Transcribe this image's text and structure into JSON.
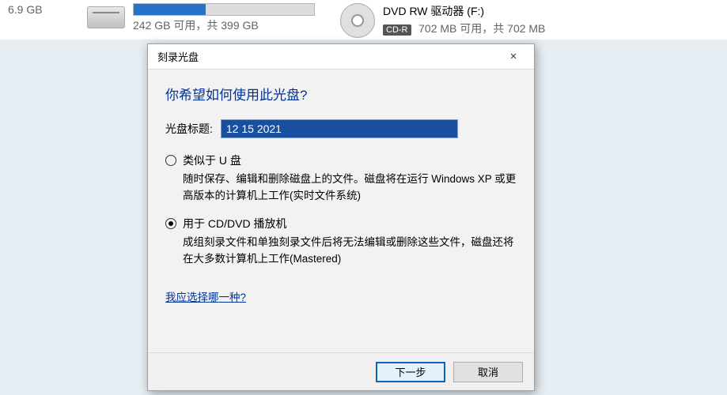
{
  "background": {
    "drive1_sub": "6.9 GB",
    "drive2_bar_fill_pct": 40,
    "drive2_sub": "242 GB 可用，共 399 GB",
    "cd_label": "DVD RW 驱动器 (F:)",
    "cd_badge": "CD-R",
    "cd_sub": "702 MB 可用，共 702 MB"
  },
  "dialog": {
    "title": "刻录光盘",
    "close_icon": "×",
    "question": "你希望如何使用此光盘?",
    "disc_title_label": "光盘标题:",
    "disc_title_value": "12 15 2021",
    "option1": {
      "label": "类似于 U 盘",
      "desc": "随时保存、编辑和删除磁盘上的文件。磁盘将在运行 Windows XP 或更高版本的计算机上工作(实时文件系统)",
      "selected": false
    },
    "option2": {
      "label": "用于 CD/DVD 播放机",
      "desc": "成组刻录文件和单独刻录文件后将无法编辑或删除这些文件，磁盘还将在大多数计算机上工作(Mastered)",
      "selected": true
    },
    "help_link": "我应选择哪一种?",
    "next_button": "下一步",
    "cancel_button": "取消"
  }
}
